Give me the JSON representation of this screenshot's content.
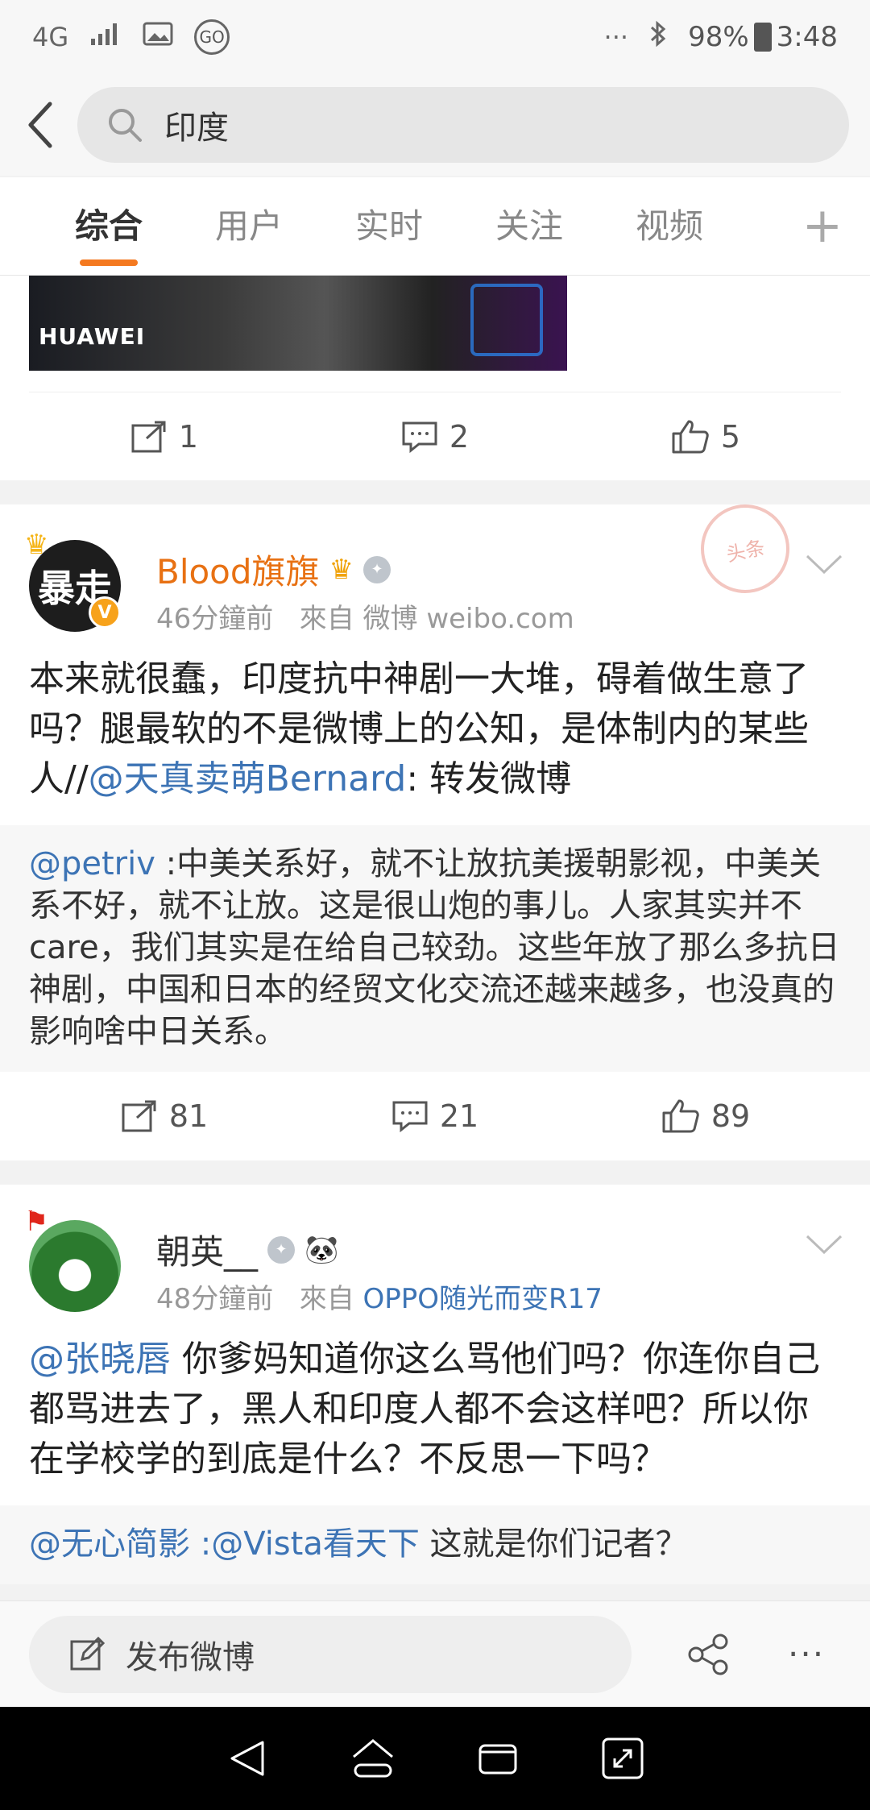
{
  "status_bar": {
    "network": "4G",
    "signal": "signal-bars",
    "extra": "···",
    "battery": "98%",
    "time": "3:48"
  },
  "search": {
    "query": "印度"
  },
  "tabs": [
    {
      "label": "综合"
    },
    {
      "label": "用户"
    },
    {
      "label": "实时"
    },
    {
      "label": "关注"
    },
    {
      "label": "视频"
    }
  ],
  "tab_plus": "+",
  "prev_card": {
    "thumb_text": "HUAWEI",
    "repost": "1",
    "comment": "2",
    "like": "5"
  },
  "post1": {
    "username": "Blood旗旗",
    "avatar_text": "暴走",
    "time": "46分鐘前",
    "from_label": "來自",
    "source": "微博 weibo.com",
    "stamp": "头条",
    "text_before": "本来就很蠢，印度抗中神剧一大堆，碍着做生意了吗？腿最软的不是微博上的公知，是体制内的某些人//",
    "mention": "@天真卖萌Bernard",
    "text_after": ": 转发微博",
    "quote_mention": "@petriv",
    "quote_text": " :中美关系好，就不让放抗美援朝影视，中美关系不好，就不让放。这是很山炮的事儿。人家其实并不care，我们其实是在给自己较劲。这些年放了那么多抗日神剧，中国和日本的经贸文化交流还越来越多，也没真的影响啥中日关系。",
    "repost": "81",
    "comment": "21",
    "like": "89"
  },
  "post2": {
    "username": "朝英__",
    "time": "48分鐘前",
    "from_label": "來自",
    "source": "OPPO随光而变R17",
    "mention": "@张晓唇",
    "text": " 你爹妈知道你这么骂他们吗？你连你自己都骂进去了，黑人和印度人都不会这样吧？所以你在学校学的到底是什么？不反思一下吗？",
    "quote_mention1": "@无心简影",
    "quote_sep": " :",
    "quote_mention2": "@Vista看天下",
    "quote_text": " 这就是你们记者？"
  },
  "bottom_bar": {
    "compose_label": "发布微博",
    "more": "···"
  },
  "colors": {
    "accent": "#f47920",
    "link": "#3d74b5",
    "username_orange": "#e87113"
  }
}
